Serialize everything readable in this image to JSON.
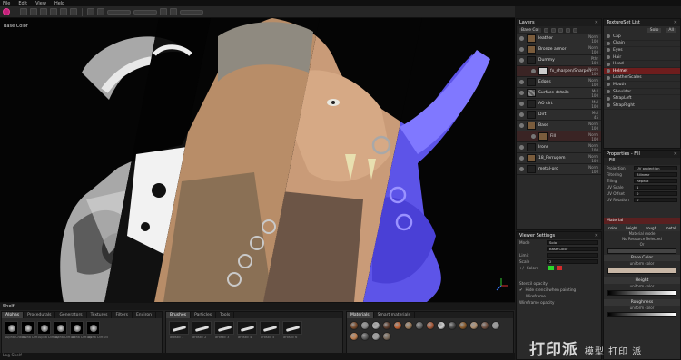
{
  "menu": [
    "File",
    "Edit",
    "View",
    "Help"
  ],
  "viewport": {
    "label": "Base Color"
  },
  "shelf": {
    "title": "Shelf",
    "tabs_left": [
      "Alphas",
      "Procedurals",
      "Generators",
      "Textures",
      "Filters",
      "Environ"
    ],
    "alphas": [
      "Alpha Cracks",
      "Alpha Dirt",
      "Alpha Dirt 02",
      "Alpha Dirt 03",
      "Alpha Dirt 04",
      "Alpha Dirt 05"
    ],
    "tabs_mid": [
      "Brushes",
      "Particles",
      "Tools"
    ],
    "brushes": [
      "artistic 1",
      "artistic 2",
      "artistic 3",
      "artistic 4",
      "artistic 5",
      "artistic 6"
    ],
    "tabs_right": [
      "Materials",
      "Smart materials"
    ]
  },
  "status": "Log   Shelf",
  "layers": {
    "title": "Layers",
    "channel": "Base Col",
    "items": [
      {
        "name": "leather",
        "blend": "Norm",
        "opacity": "100"
      },
      {
        "name": "Bronze armor",
        "blend": "Norm",
        "opacity": "100"
      },
      {
        "name": "Dummy",
        "blend": "Pthr",
        "opacity": "100"
      },
      {
        "name": "fx_sharpen/Sharpen",
        "blend": "Norm",
        "opacity": "100"
      },
      {
        "name": "Edges",
        "blend": "Norm",
        "opacity": "100"
      },
      {
        "name": "Surface details",
        "blend": "Mul",
        "opacity": "100"
      },
      {
        "name": "AO dirt",
        "blend": "Mul",
        "opacity": "100"
      },
      {
        "name": "Dirt",
        "blend": "Mul",
        "opacity": "45"
      },
      {
        "name": "Base",
        "blend": "Norm",
        "opacity": "100"
      },
      {
        "name": "Fill",
        "blend": "Norm",
        "opacity": "100"
      },
      {
        "name": "Irons",
        "blend": "Norm",
        "opacity": "100"
      },
      {
        "name": "18_Ferrugem",
        "blend": "Norm",
        "opacity": "100"
      },
      {
        "name": "metal-orc",
        "blend": "Norm",
        "opacity": "100"
      }
    ]
  },
  "textureset": {
    "title": "TextureSet List",
    "buttons": [
      "Solo",
      "All"
    ],
    "items": [
      "Cap",
      "Chain",
      "Eyes",
      "Hair",
      "Head",
      "Helmet",
      "LeatherScales",
      "Mouth",
      "Shoulder",
      "StrapLeft",
      "StrapRight"
    ],
    "selected": "Helmet"
  },
  "viewer": {
    "title": "Viewer Settings",
    "rows": [
      {
        "label": "Mode",
        "value": "Solo"
      },
      {
        "label": "",
        "value": "Base Color"
      },
      {
        "label": "Limit",
        "value": ""
      },
      {
        "label": "Scale",
        "value": "2"
      },
      {
        "label": "+/- Colors",
        "value": ""
      }
    ],
    "stencil_label": "Stencil opacity",
    "hide_stencil": "Hide stencil when painting",
    "wireframe": "Wireframe",
    "wire_opacity": "Wireframe opacity",
    "colors": {
      "green": "#2bd52b",
      "red": "#d52b2b"
    }
  },
  "properties": {
    "title": "Properties - Fill",
    "section": "Fill",
    "rows": [
      {
        "label": "Projection",
        "value": "UV projection"
      },
      {
        "label": "Filtering",
        "value": "Bilinear"
      },
      {
        "label": "Tiling",
        "value": "Repeat"
      },
      {
        "label": "UV Scale",
        "value": "1"
      },
      {
        "label": "UV Offset",
        "value": "0"
      },
      {
        "label": "UV Rotation",
        "value": "0"
      }
    ],
    "material_head": "Material",
    "channels": [
      "color",
      "height",
      "rough",
      "metal"
    ],
    "material_mode": "Material mode",
    "no_resource": "No Resource Selected",
    "or": "Or",
    "base_color": "Base Color",
    "uniform_color": "uniform color",
    "height": "Height",
    "roughness": "Roughness"
  },
  "watermark": {
    "logo": "打印派",
    "sub": "模型 打印 派"
  }
}
